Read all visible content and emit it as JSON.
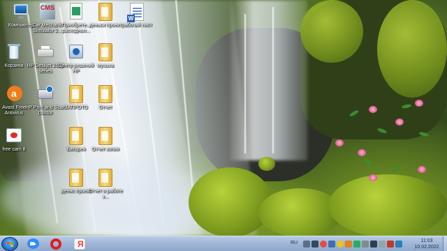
{
  "desktop": {
    "icons": [
      {
        "label": "Компьютер",
        "icon": "computer-icon"
      },
      {
        "label": "Car Mechanic Simulator 2...",
        "icon": "game-cms-icon"
      },
      {
        "label": "Приобрете... расходных...",
        "icon": "supplies-icon"
      },
      {
        "label": "деньси проект",
        "icon": "folder-icon"
      },
      {
        "label": "рабочий лист",
        "icon": "word-document-icon"
      },
      {
        "label": "Корзина",
        "icon": "recycle-bin-icon"
      },
      {
        "label": "HP Deskjet 2600 series",
        "icon": "printer-icon"
      },
      {
        "label": "Центр решений HP",
        "icon": "hp-solution-center-icon"
      },
      {
        "label": "музыка",
        "icon": "folder-icon"
      },
      {
        "label": "Avast Free Antivirus",
        "icon": "avast-icon"
      },
      {
        "label": "HP Print and Scan Doctor",
        "icon": "hp-scan-doctor-icon"
      },
      {
        "label": "ЗАПРОТО",
        "icon": "folder-icon"
      },
      {
        "label": "Отчет",
        "icon": "folder-icon"
      },
      {
        "label": "free cam 8",
        "icon": "free-cam-icon"
      },
      {
        "label": "Батарея",
        "icon": "folder-icon"
      },
      {
        "label": "Отчет копия",
        "icon": "folder-icon"
      },
      {
        "label": "денис проект",
        "icon": "folder-icon"
      },
      {
        "label": "Отчет о работе з...",
        "icon": "folder-icon"
      }
    ]
  },
  "taskbar": {
    "pinned": [
      {
        "icon": "zoom-icon"
      },
      {
        "icon": "opera-icon"
      },
      {
        "icon": "yandex-browser-icon"
      }
    ],
    "language": "RU",
    "clock": {
      "time": "11:03",
      "date": "10.02.2022"
    },
    "tray_icons": [
      "network-icon",
      "volume-icon",
      "antivirus-icon",
      "update-icon",
      "chat-icon",
      "bluetooth-icon",
      "battery-icon",
      "printer-icon",
      "flag-icon",
      "arrow-icon",
      "speaker-icon",
      "power-icon"
    ]
  },
  "colors": {
    "taskbar": "#9fb6d6",
    "folder": "#f0c85a",
    "avast": "#f07d1b",
    "opera": "#e11b22",
    "zoom": "#2d8cff",
    "yandex": "#ff3333"
  }
}
